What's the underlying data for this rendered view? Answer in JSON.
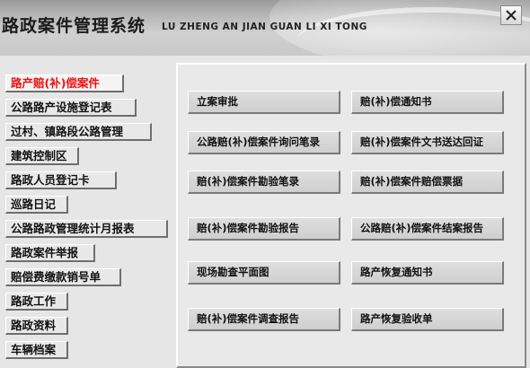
{
  "header": {
    "title_cn": "路政案件管理系统",
    "title_en": "LU ZHENG AN JIAN GUAN LI XI TONG",
    "close_label": "×"
  },
  "nav": {
    "active_color": "#ee1111",
    "items": [
      {
        "label": "路产赔(补)偿案件",
        "active": true
      },
      {
        "label": "公路路产设施登记表"
      },
      {
        "label": "过村、镇路段公路管理"
      },
      {
        "label": "建筑控制区"
      },
      {
        "label": "路政人员登记卡"
      },
      {
        "label": "巡路日记"
      },
      {
        "label": "公路路政管理统计月报表"
      },
      {
        "label": "路政案件举报"
      },
      {
        "label": "赔偿费缴款销号单"
      },
      {
        "label": "路政工作"
      },
      {
        "label": "路政资料"
      },
      {
        "label": "车辆档案"
      }
    ]
  },
  "panel": {
    "buttons": [
      {
        "label": "立案审批"
      },
      {
        "label": "赔(补)偿通知书"
      },
      {
        "label": "公路赔(补)偿案件询问笔录"
      },
      {
        "label": "赔(补)偿案件文书送达回证"
      },
      {
        "label": "赔(补)偿案件勘验笔录"
      },
      {
        "label": "赔(补)偿案件赔偿票据"
      },
      {
        "label": "赔(补)偿案件勘验报告"
      },
      {
        "label": "公路赔(补)偿案件结案报告"
      },
      {
        "label": "现场勘查平面图"
      },
      {
        "label": "路产恢复通知书"
      },
      {
        "label": "赔(补)偿案件调查报告"
      },
      {
        "label": "路产恢复验收单"
      }
    ]
  }
}
